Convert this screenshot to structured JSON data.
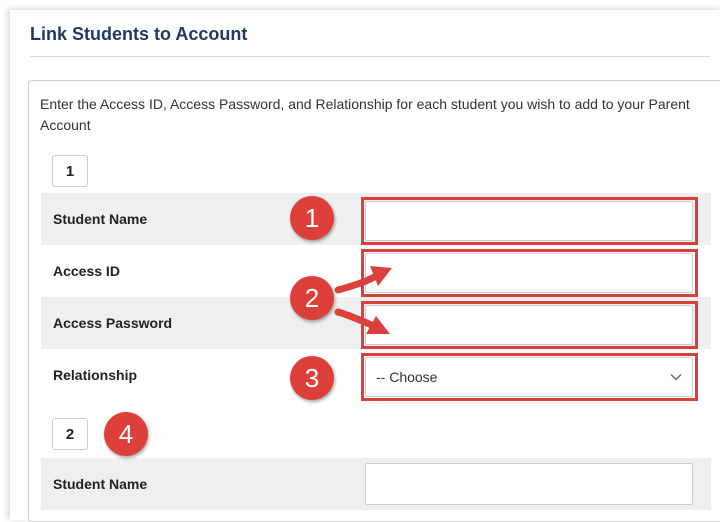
{
  "page": {
    "title": "Link Students to Account",
    "instructions": "Enter the Access ID, Access Password, and Relationship for each student you wish to add to your Parent Account"
  },
  "students": [
    {
      "number": "1",
      "fields": {
        "student_name": {
          "label": "Student Name",
          "value": ""
        },
        "access_id": {
          "label": "Access ID",
          "value": ""
        },
        "access_password": {
          "label": "Access Password",
          "value": ""
        },
        "relationship": {
          "label": "Relationship",
          "selected": "-- Choose"
        }
      }
    },
    {
      "number": "2",
      "fields": {
        "student_name": {
          "label": "Student Name",
          "value": ""
        }
      }
    }
  ],
  "annotations": [
    {
      "label": "1",
      "target": "student-name-input"
    },
    {
      "label": "2",
      "target": "access-id-and-password-inputs"
    },
    {
      "label": "3",
      "target": "relationship-select"
    },
    {
      "label": "4",
      "target": "student-number-2"
    }
  ],
  "colors": {
    "title": "#1f3a63",
    "annotation_red": "#dd3f3a",
    "row_shade": "#efefef",
    "border": "#cccccc"
  },
  "icons": {
    "select_arrow": "chevron-down-icon",
    "callout_arrow": "arrow-right-icon"
  }
}
